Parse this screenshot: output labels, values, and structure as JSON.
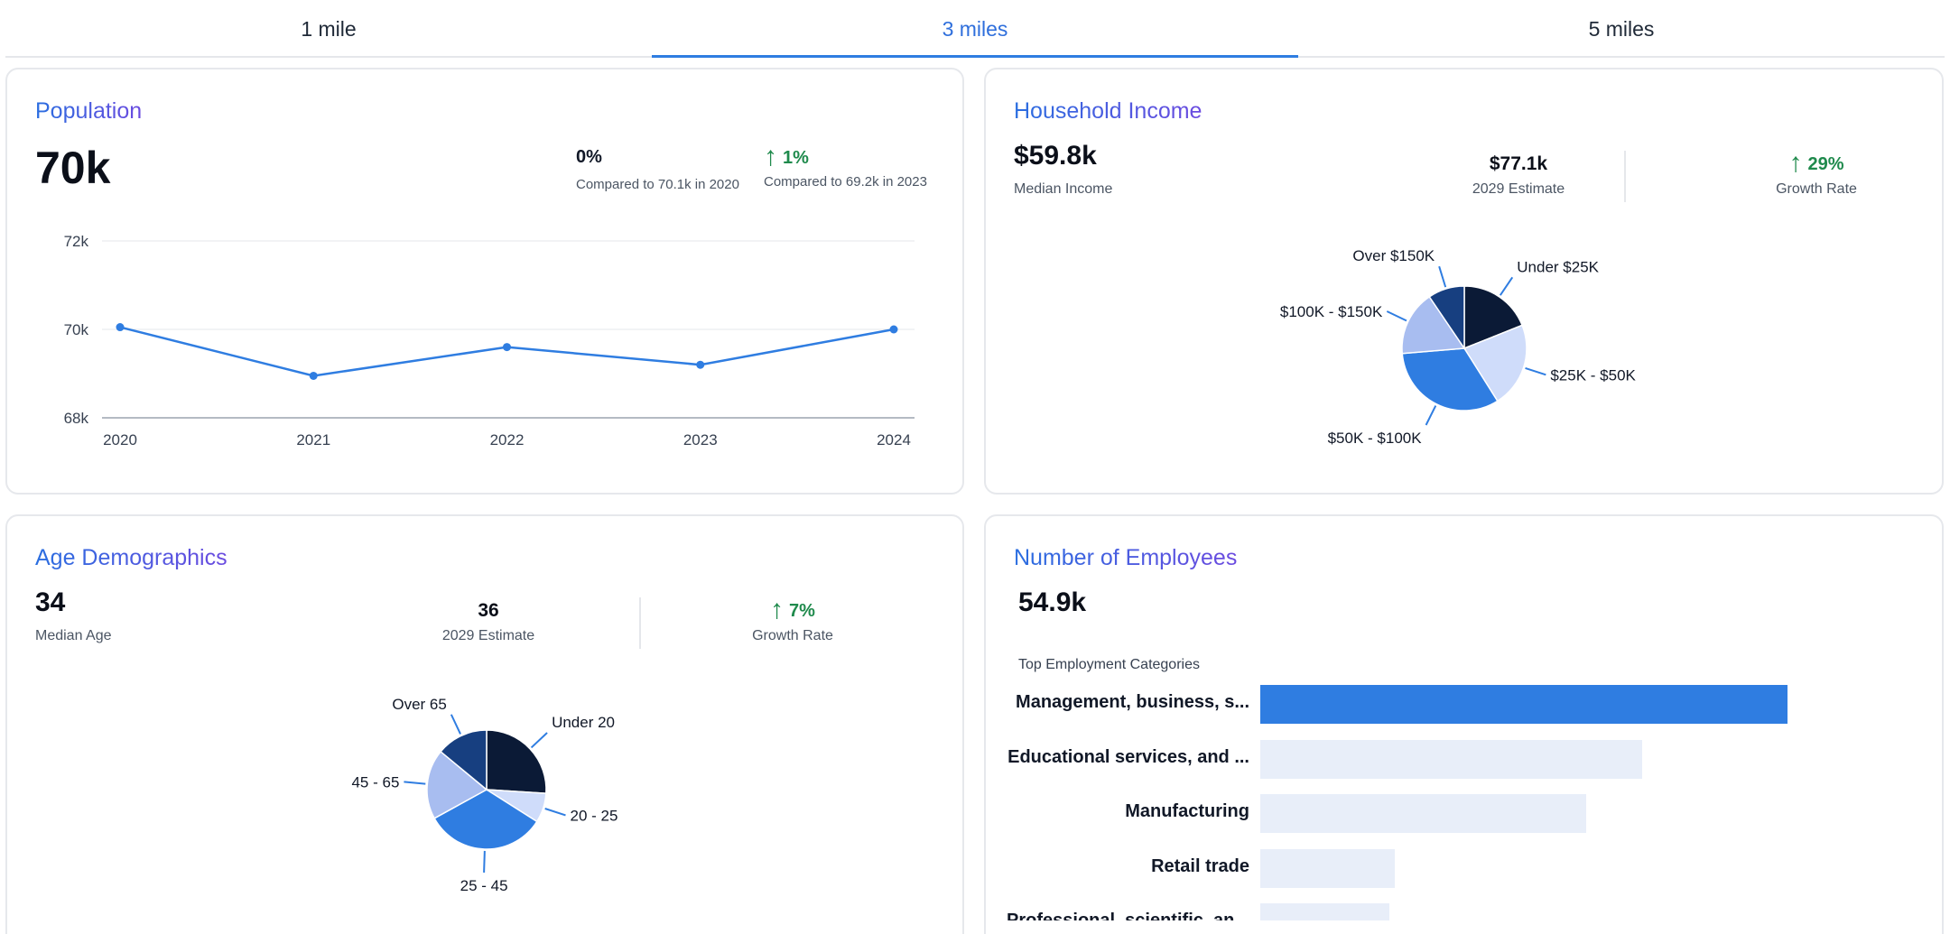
{
  "tabs": [
    {
      "label": "1 mile",
      "active": false
    },
    {
      "label": "3 miles",
      "active": true
    },
    {
      "label": "5 miles",
      "active": false
    }
  ],
  "population": {
    "title": "Population",
    "value": "70k",
    "comparisons": [
      {
        "value": "0%",
        "caption": "Compared to 70.1k in 2020",
        "trend": "none"
      },
      {
        "value": "1%",
        "caption": "Compared to 69.2k in 2023",
        "trend": "up"
      }
    ],
    "chart_data": {
      "type": "line",
      "x": [
        "2020",
        "2021",
        "2022",
        "2023",
        "2024"
      ],
      "series": [
        {
          "values": [
            70.05,
            68.95,
            69.6,
            69.2,
            70.0
          ]
        }
      ],
      "ylim": [
        68,
        72
      ],
      "yticks": [
        "72k",
        "70k",
        "68k"
      ],
      "grid": true
    }
  },
  "household_income": {
    "title": "Household Income",
    "median_value": "$59.8k",
    "median_label": "Median Income",
    "estimate_value": "$77.1k",
    "estimate_label": "2029 Estimate",
    "growth_value": "29%",
    "growth_label": "Growth Rate",
    "chart_data": {
      "type": "pie",
      "categories": [
        "Under $25K",
        "$25K - $50K",
        "$50K - $100K",
        "$100K - $150K",
        "Over $150K"
      ],
      "values": [
        18,
        21,
        31,
        16,
        9
      ]
    }
  },
  "age": {
    "title": "Age Demographics",
    "median_value": "34",
    "median_label": "Median Age",
    "estimate_value": "36",
    "estimate_label": "2029 Estimate",
    "growth_value": "7%",
    "growth_label": "Growth Rate",
    "chart_data": {
      "type": "pie",
      "categories": [
        "Under 20",
        "20 - 25",
        "25 - 45",
        "45 - 65",
        "Over 65"
      ],
      "values": [
        26,
        8,
        33,
        19,
        14
      ]
    }
  },
  "employees": {
    "title": "Number of Employees",
    "value": "54.9k",
    "subtitle": "Top Employment Categories",
    "chart_data": {
      "type": "bar",
      "categories": [
        "Management, business, s...",
        "Educational services, and ...",
        "Manufacturing",
        "Retail trade",
        "Professional, scientific, an..."
      ],
      "values": [
        100,
        72.4,
        61.8,
        25.5,
        24.5
      ]
    }
  },
  "colors": {
    "accent": "#2f7de1",
    "pie": [
      "#0b1a36",
      "#cfdcfa",
      "#2f7de1",
      "#a8bdf0",
      "#173f80"
    ],
    "bar_highlight": "#2f7de1",
    "bar_muted": "#e8eef9",
    "growth": "#1f8a4c"
  }
}
